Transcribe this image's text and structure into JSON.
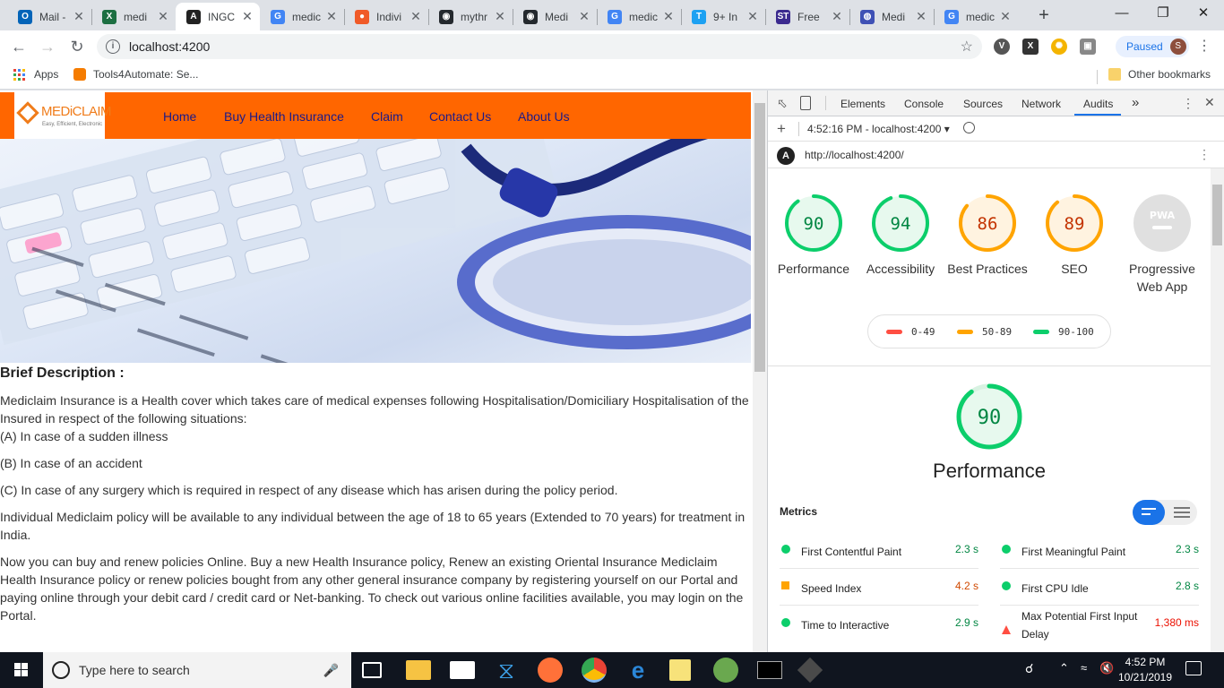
{
  "browser": {
    "tabs": [
      {
        "title": "Mail -",
        "icon": "outlook-icon",
        "color": "#0364b8",
        "glyph": "O"
      },
      {
        "title": "medi",
        "icon": "excel-icon",
        "color": "#1d6f42",
        "glyph": "X"
      },
      {
        "title": "INGC",
        "icon": "angular-icon",
        "color": "#222222",
        "glyph": "A"
      },
      {
        "title": "medic",
        "icon": "google-icon",
        "color": "#4285f4",
        "glyph": "G"
      },
      {
        "title": "Indivi",
        "icon": "record-icon",
        "color": "#f05a28",
        "glyph": "●"
      },
      {
        "title": "mythr",
        "icon": "github-icon",
        "color": "#24292e",
        "glyph": "◉"
      },
      {
        "title": "Medi",
        "icon": "github-icon",
        "color": "#24292e",
        "glyph": "◉"
      },
      {
        "title": "medic",
        "icon": "google-icon",
        "color": "#4285f4",
        "glyph": "G"
      },
      {
        "title": "9+ In",
        "icon": "t-icon",
        "color": "#1da1f2",
        "glyph": "T"
      },
      {
        "title": "Free",
        "icon": "st-icon",
        "color": "#3b2a8f",
        "glyph": "ST"
      },
      {
        "title": "Medi",
        "icon": "globe-icon",
        "color": "#3f51b5",
        "glyph": "◍"
      },
      {
        "title": "medic",
        "icon": "google-icon",
        "color": "#4285f4",
        "glyph": "G"
      }
    ],
    "new_tab": "+",
    "url": "localhost:4200",
    "paused_label": "Paused",
    "profile_initial": "S",
    "bookmarks": {
      "apps": "Apps",
      "tools": "Tools4Automate: Se...",
      "other": "Other bookmarks"
    }
  },
  "site": {
    "logo_name": "MEDiCLAIM",
    "logo_tagline": "Easy, Efficient, Electronic",
    "nav": [
      "Home",
      "Buy Health Insurance",
      "Claim",
      "Contact Us",
      "About Us"
    ],
    "heading": "Brief Description :",
    "paragraphs": [
      "Mediclaim Insurance is a Health cover which takes care of medical expenses following Hospitalisation/Domiciliary Hospitalisation of the Insured in respect of the following situations:",
      "(A) In case of a sudden illness",
      "(B) In case of an accident",
      "(C) In case of any surgery which is required in respect of any disease which has arisen during the policy period.",
      "Individual Mediclaim policy will be available to any individual between the age of 18 to 65 years (Extended to 70 years) for treatment in India.",
      "Now you can buy and renew policies Online. Buy a new Health Insurance policy, Renew an existing Oriental Insurance Mediclaim Health Insurance policy or renew policies bought from any other general insurance company by registering yourself on our Portal and paying online through your debit card / credit card or Net-banking. To check out various online facilities available, you may login on the Portal."
    ]
  },
  "devtools": {
    "tabs": [
      "Elements",
      "Console",
      "Sources",
      "Network",
      "Audits"
    ],
    "more": "»",
    "run_label": "4:52:16 PM - localhost:4200 ▾",
    "audited_url": "http://localhost:4200/",
    "scores": [
      {
        "label": "Performance",
        "value": 90,
        "color": "#0cce6b"
      },
      {
        "label": "Accessibility",
        "value": 94,
        "color": "#0cce6b"
      },
      {
        "label": "Best Practices",
        "value": 86,
        "color": "#ffa400"
      },
      {
        "label": "SEO",
        "value": 89,
        "color": "#ffa400"
      }
    ],
    "pwa_label": "Progressive Web App",
    "pwa_badge": "PWA",
    "legend": [
      {
        "range": "0-49",
        "color": "#ff4e42"
      },
      {
        "range": "50-89",
        "color": "#ffa400"
      },
      {
        "range": "90-100",
        "color": "#0cce6b"
      }
    ],
    "perf_score": 90,
    "perf_title": "Performance",
    "metrics_heading": "Metrics",
    "metrics": [
      {
        "name": "First Contentful Paint",
        "value": "2.3 s",
        "status": "pass"
      },
      {
        "name": "First Meaningful Paint",
        "value": "2.3 s",
        "status": "pass"
      },
      {
        "name": "Speed Index",
        "value": "4.2 s",
        "status": "average"
      },
      {
        "name": "First CPU Idle",
        "value": "2.8 s",
        "status": "pass"
      },
      {
        "name": "Time to Interactive",
        "value": "2.9 s",
        "status": "pass"
      },
      {
        "name": "Max Potential First Input Delay",
        "value": "1,380 ms",
        "status": "fail"
      }
    ],
    "status_colors": {
      "pass": "#0cce6b",
      "average": "#ffa400",
      "fail": "#ff4e42"
    },
    "value_colors": {
      "pass": "#018642",
      "average": "#d04900",
      "fail": "#eb0f00"
    }
  },
  "taskbar": {
    "search_placeholder": "Type here to search",
    "time": "4:52 PM",
    "date": "10/21/2019"
  }
}
